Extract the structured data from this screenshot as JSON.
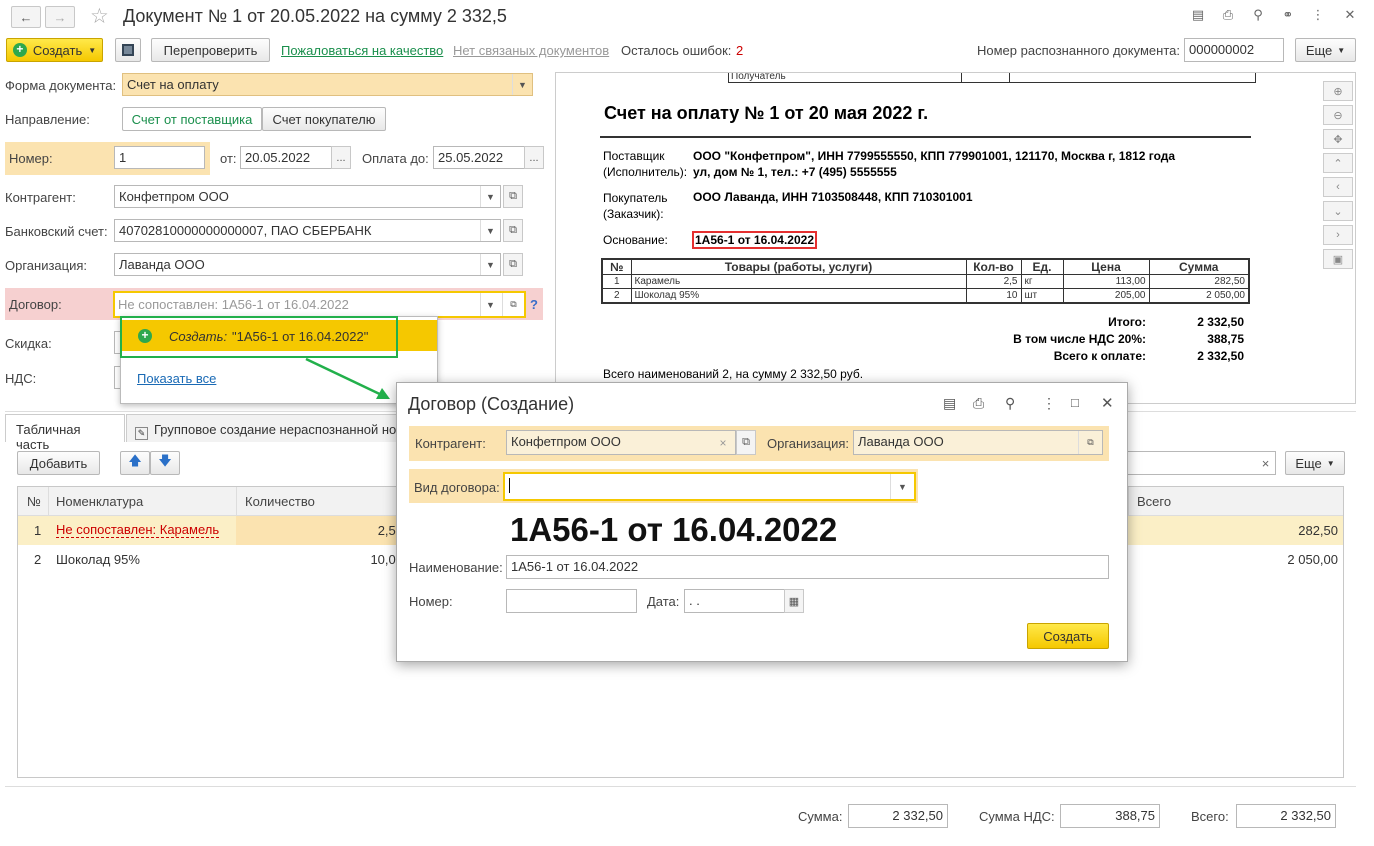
{
  "window": {
    "title": "Документ № 1 от 20.05.2022 на сумму 2 332,5"
  },
  "toolbar": {
    "create_label": "Создать",
    "recheck_label": "Перепроверить",
    "complain_link": "Пожаловаться на качество",
    "no_linked_docs": "Нет связаных документов",
    "errors_left_label": "Осталось ошибок:",
    "errors_left_value": "2",
    "recognized_doc_label": "Номер распознанного документа:",
    "recognized_doc_value": "000000002",
    "more_label": "Еще"
  },
  "form": {
    "doc_form_label": "Форма документа:",
    "doc_form_value": "Счет на оплату",
    "direction_label": "Направление:",
    "direction_options": [
      "Счет от поставщика",
      "Счет покупателю"
    ],
    "number_label": "Номер:",
    "number_value": "1",
    "date_label": "от:",
    "date_value": "20.05.2022",
    "pay_until_label": "Оплата до:",
    "pay_until_value": "25.05.2022",
    "counterparty_label": "Контрагент:",
    "counterparty_value": "Конфетпром ООО",
    "bank_label": "Банковский счет:",
    "bank_value": "40702810000000000007, ПАО СБЕРБАНК",
    "org_label": "Организация:",
    "org_value": "Лаванда ООО",
    "contract_label": "Договор:",
    "contract_placeholder": "Не сопоставлен: 1А56-1 от 16.04.2022",
    "help_mark": "?",
    "discount_label": "Скидка:",
    "vat_label": "НДС:"
  },
  "dropdown": {
    "create_prefix": "Создать:",
    "create_value": "\"1А56-1 от 16.04.2022\"",
    "show_all": "Показать все"
  },
  "tabs": [
    {
      "label": "Табличная часть"
    },
    {
      "label": "Групповое создание нераспознанной но"
    }
  ],
  "table_toolbar": {
    "add_label": "Добавить",
    "clear_x": "×",
    "more_label": "Еще"
  },
  "table": {
    "headers": {
      "num": "№",
      "item": "Номенклатура",
      "qty": "Количество",
      "total": "Всего"
    },
    "rows": [
      {
        "num": "1",
        "item": "Не сопоставлен: Карамель",
        "qty": "2,50",
        "total": "282,50"
      },
      {
        "num": "2",
        "item": "Шоколад 95%",
        "qty": "10,00",
        "total": "2 050,00"
      }
    ]
  },
  "preview": {
    "top_cell": "Получатель",
    "title": "Счет на оплату № 1 от 20 мая 2022 г.",
    "supplier_label_1": "Поставщик",
    "supplier_label_2": "(Исполнитель):",
    "supplier_value_1": "ООО \"Конфетпром\", ИНН 7799555550, КПП 779901001, 121170, Москва г, 1812 года",
    "supplier_value_2": "ул, дом № 1, тел.: +7 (495) 5555555",
    "buyer_label_1": "Покупатель",
    "buyer_label_2": "(Заказчик):",
    "buyer_value": "ООО Лаванда, ИНН 7103508448, КПП 710301001",
    "basis_label": "Основание:",
    "basis_value": "1А56-1 от 16.04.2022",
    "inv_headers": [
      "№",
      "Товары (работы, услуги)",
      "Кол-во",
      "Ед.",
      "Цена",
      "Сумма"
    ],
    "inv_rows": [
      [
        "1",
        "Карамель",
        "2,5",
        "кг",
        "113,00",
        "282,50"
      ],
      [
        "2",
        "Шоколад 95%",
        "10",
        "шт",
        "205,00",
        "2 050,00"
      ]
    ],
    "total_label": "Итого:",
    "total_value": "2 332,50",
    "vat_label": "В том числе НДС 20%:",
    "vat_value": "388,75",
    "topay_label": "Всего к оплате:",
    "topay_value": "2 332,50",
    "summary": "Всего наименований 2, на сумму 2 332,50 руб."
  },
  "dialog": {
    "title": "Договор (Создание)",
    "counterparty_label": "Контрагент:",
    "counterparty_value": "Конфетпром ООО",
    "org_label": "Организация:",
    "org_value": "Лаванда ООО",
    "kind_label": "Вид договора:",
    "big_caption": "1А56-1 от 16.04.2022",
    "name_label": "Наименование:",
    "name_value": "1А56-1 от 16.04.2022",
    "number_label": "Номер:",
    "date_label": "Дата:",
    "date_value": " .  .",
    "create_button": "Создать"
  },
  "footer": {
    "sum_label": "Сумма:",
    "sum_value": "2 332,50",
    "vat_label": "Сумма НДС:",
    "vat_value": "388,75",
    "total_label": "Всего:",
    "total_value": "2 332,50"
  },
  "colors": {
    "accent_yellow": "#f5c800",
    "highlight_field": "#fbe3b0",
    "error_bg": "#f6d0d0",
    "link_green": "#1a8f4c",
    "annotation_green": "#22b04b",
    "error_red": "#cc0000"
  }
}
